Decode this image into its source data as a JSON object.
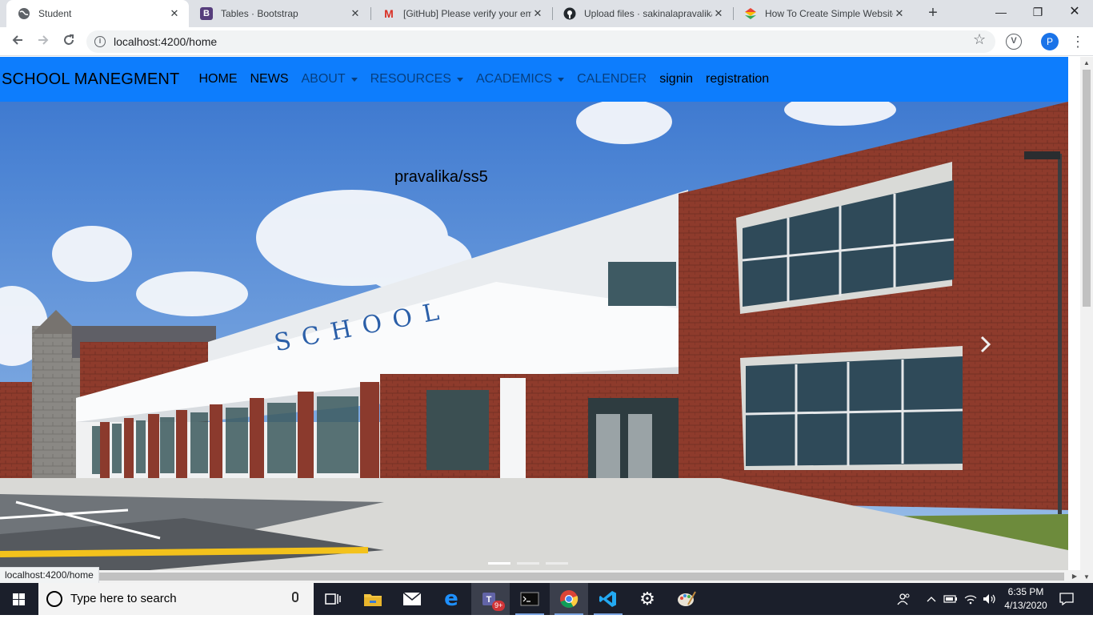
{
  "browser": {
    "tabs": [
      {
        "title": "Student",
        "favicon": "globe-icon"
      },
      {
        "title": "Tables · Bootstrap",
        "favicon": "bootstrap-icon"
      },
      {
        "title": "[GitHub] Please verify your em",
        "favicon": "gmail-icon"
      },
      {
        "title": "Upload files · sakinalapravalika",
        "favicon": "github-icon"
      },
      {
        "title": "How To Create Simple Website",
        "favicon": "site-icon"
      }
    ],
    "url": "localhost:4200/home",
    "profile_initial": "P",
    "extension_label": "V",
    "status_url": "localhost:4200/home"
  },
  "page": {
    "brand": "SCHOOL MANEGMENT",
    "nav": [
      {
        "label": "HOME"
      },
      {
        "label": "NEWS"
      },
      {
        "label": "ABOUT"
      },
      {
        "label": "RESOURCES"
      },
      {
        "label": "ACADEMICS"
      },
      {
        "label": "CALENDER"
      },
      {
        "label": "signin"
      },
      {
        "label": "registration"
      }
    ],
    "carousel": {
      "caption": "pravalika/ss5",
      "building_sign": "SCHOOL",
      "slide_count": 3,
      "active_slide": 1
    },
    "navbar_color": "#0d7dfd"
  },
  "taskbar": {
    "search_placeholder": "Type here to search",
    "teams_badge": "9+",
    "time": "6:35 PM",
    "date": "4/13/2020"
  }
}
